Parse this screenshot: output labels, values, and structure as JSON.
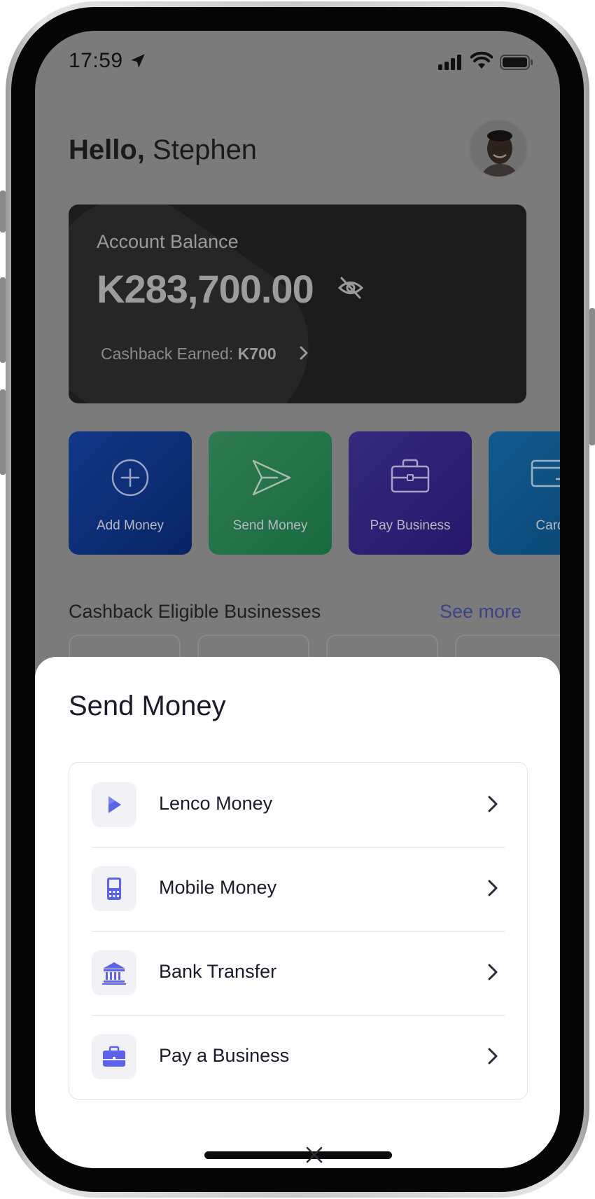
{
  "status_bar": {
    "time": "17:59"
  },
  "home": {
    "greeting_prefix": "Hello,",
    "greeting_name": "Stephen",
    "balance_card": {
      "label": "Account Balance",
      "amount": "K283,700.00",
      "cashback_label": "Cashback Earned:",
      "cashback_value": "K700"
    },
    "actions": [
      {
        "label": "Add Money",
        "icon": "plus-circle-icon",
        "color": "#0b2a78"
      },
      {
        "label": "Send Money",
        "icon": "paper-plane-icon",
        "color": "#1c6b42"
      },
      {
        "label": "Pay Business",
        "icon": "briefcase-icon",
        "color": "#2c1f6e"
      },
      {
        "label": "Card",
        "icon": "card-icon",
        "color": "#0d4f7f"
      }
    ],
    "section_title": "Cashback Eligible Businesses",
    "see_more": "See more"
  },
  "sheet": {
    "title": "Send Money",
    "options": [
      {
        "label": "Lenco Money",
        "icon": "lenco-logo-icon"
      },
      {
        "label": "Mobile Money",
        "icon": "mobile-phone-icon"
      },
      {
        "label": "Bank Transfer",
        "icon": "bank-icon"
      },
      {
        "label": "Pay a Business",
        "icon": "briefcase-icon"
      }
    ]
  },
  "colors": {
    "accent": "#5c63ea",
    "text_dark": "#1b1b2b",
    "overlay": "#7b7b7b"
  }
}
